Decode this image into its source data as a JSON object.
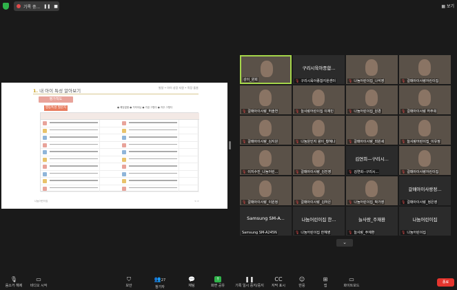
{
  "topbar": {
    "recording_label": "기록 중...",
    "pause_label": "❚❚",
    "stop_label": "■",
    "view_label": "보기"
  },
  "share": {
    "title_num": "1.",
    "title_text": "내 아이 특성 알아보기",
    "tr_text": "발달 • 아이 성장 지원 • 직장 돌봄",
    "eval_tag": "평가척도",
    "criteria_tag": "행동특성 질문지",
    "legend": "● 해당없음 ● 거의아님 ● 가끔 그렇다 ● 자주 그렇다",
    "foot_left": "나눔어린이집",
    "foot_right": "< >"
  },
  "participants": [
    {
      "name": "강이_원희",
      "big": "",
      "video": true,
      "mic_muted": false,
      "active": true
    },
    {
      "name": "구리시육아종합지원센터",
      "big": "구리시육아종합...",
      "video": false,
      "mic_muted": true,
      "active": false
    },
    {
      "name": "나눔어린이집_나석영",
      "big": "",
      "video": true,
      "mic_muted": true,
      "active": false
    },
    {
      "name": "갈매아이사랑어린이집",
      "big": "",
      "video": true,
      "mic_muted": true,
      "active": false
    },
    {
      "name": "갈매아이사랑_허솔연",
      "big": "",
      "video": true,
      "mic_muted": true,
      "active": false
    },
    {
      "name": "늘사랑어린이집 이재민",
      "big": "",
      "video": true,
      "mic_muted": true,
      "active": false
    },
    {
      "name": "나눔어린이집_원경",
      "big": "",
      "video": true,
      "mic_muted": true,
      "active": false
    },
    {
      "name": "갈매아이사랑 허주희",
      "big": "",
      "video": true,
      "mic_muted": true,
      "active": false
    },
    {
      "name": "갈매아이사랑_김지원",
      "big": "",
      "video": true,
      "mic_muted": true,
      "active": false
    },
    {
      "name": "나눔원인지 왕이_황혜나",
      "big": "",
      "video": true,
      "mic_muted": true,
      "active": false
    },
    {
      "name": "갈매아이사랑_최원세",
      "big": "",
      "video": true,
      "mic_muted": true,
      "active": false
    },
    {
      "name": "늘사랑어린이집_이유정",
      "big": "",
      "video": true,
      "mic_muted": true,
      "active": false
    },
    {
      "name": "이지수진_나눔어린...",
      "big": "",
      "video": true,
      "mic_muted": true,
      "active": false
    },
    {
      "name": "갈매아이사랑_김진영",
      "big": "",
      "video": true,
      "mic_muted": true,
      "active": false
    },
    {
      "name": "김연희--구리시...",
      "big": "김연희—구리시...",
      "video": false,
      "mic_muted": true,
      "active": false
    },
    {
      "name": "갈매아이사랑어린이집",
      "big": "",
      "video": true,
      "mic_muted": true,
      "active": false
    },
    {
      "name": "갈매아이사랑_이원정",
      "big": "",
      "video": true,
      "mic_muted": true,
      "active": false
    },
    {
      "name": "갈매아이사랑_김하은",
      "big": "",
      "video": true,
      "mic_muted": true,
      "active": false
    },
    {
      "name": "나눔어린이집_박가영",
      "big": "",
      "video": true,
      "mic_muted": true,
      "active": false
    },
    {
      "name": "갈매아이사랑_정은영",
      "big": "갈매아이사랑정...",
      "video": false,
      "mic_muted": true,
      "active": false
    },
    {
      "name": "Samsung SM-A245N",
      "big": "Samsung SM-A...",
      "video": false,
      "mic_muted": false,
      "active": false
    },
    {
      "name": "나눔어린이집 한혜영",
      "big": "나눔어린이집 한...",
      "video": false,
      "mic_muted": true,
      "active": false
    },
    {
      "name": "늘사랑_주재환",
      "big": "늘사랑_주재환",
      "video": false,
      "mic_muted": true,
      "active": false
    },
    {
      "name": "나눔어린이집",
      "big": "나눔어린이집",
      "video": false,
      "mic_muted": true,
      "active": false
    }
  ],
  "toolbar": {
    "mute_label": "음소거 해제",
    "video_label": "비디오 시작",
    "security_label": "보안",
    "participants_label": "참가자",
    "participants_count": "27",
    "chat_label": "채팅",
    "share_label": "화면 공유",
    "record_label": "기록 일시 중지/중지",
    "captions_label": "자막 표시",
    "reactions_label": "반응",
    "apps_label": "앱",
    "whiteboard_label": "화이트보드",
    "end_label": "종료"
  }
}
